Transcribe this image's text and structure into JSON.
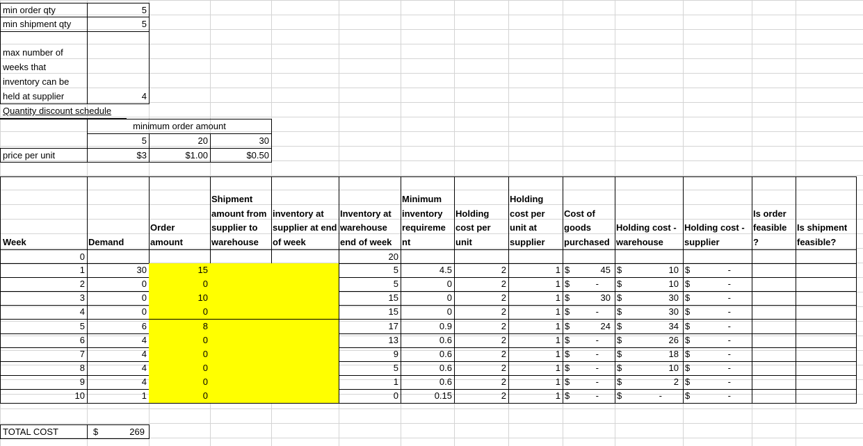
{
  "params": {
    "min_order_qty_label": "min order qty",
    "min_order_qty": "5",
    "min_shipment_qty_label": "min shipment qty",
    "min_shipment_qty": "5",
    "max_weeks_label_1": "max number of",
    "max_weeks_label_2": "weeks that",
    "max_weeks_label_3": "inventory can be",
    "max_weeks_label_4": "held at supplier",
    "max_weeks": "4"
  },
  "discount": {
    "title": "Quantity discount schedule",
    "min_order_label": "minimum order amount",
    "amounts": [
      "5",
      "20",
      "30"
    ],
    "price_label": "price per unit",
    "prices": [
      "$3",
      "$1.00",
      "$0.50"
    ]
  },
  "headers": {
    "week": "Week",
    "demand": "Demand",
    "order": "Order amount",
    "shipment": "Shipment amount from supplier to warehouse",
    "inv_supplier": "inventory at supplier at end of week",
    "inv_warehouse": "Inventory at warehouse end of week",
    "min_inv": "Minimum inventory requireme nt",
    "holding_unit": "Holding cost per unit",
    "holding_supplier_unit": "Holding cost per unit at supplier",
    "cost_goods": "Cost of goods purchased",
    "hc_warehouse": "Holding cost - warehouse",
    "hc_supplier": "Holding cost - supplier",
    "order_feasible": "Is order feasible ?",
    "ship_feasible": "Is shipment feasible?"
  },
  "rows": [
    {
      "week": "0",
      "demand": "",
      "order": "",
      "inv_wh": "20",
      "min_inv": "",
      "hold": "",
      "hold_sup": "",
      "cog": "",
      "hcw": "",
      "hcs": ""
    },
    {
      "week": "1",
      "demand": "30",
      "order": "15",
      "inv_wh": "5",
      "min_inv": "4.5",
      "hold": "2",
      "hold_sup": "1",
      "cog": "45",
      "hcw": "10",
      "hcs": "-"
    },
    {
      "week": "2",
      "demand": "0",
      "order": "0",
      "inv_wh": "5",
      "min_inv": "0",
      "hold": "2",
      "hold_sup": "1",
      "cog": "-",
      "hcw": "10",
      "hcs": "-"
    },
    {
      "week": "3",
      "demand": "0",
      "order": "10",
      "inv_wh": "15",
      "min_inv": "0",
      "hold": "2",
      "hold_sup": "1",
      "cog": "30",
      "hcw": "30",
      "hcs": "-"
    },
    {
      "week": "4",
      "demand": "0",
      "order": "0",
      "inv_wh": "15",
      "min_inv": "0",
      "hold": "2",
      "hold_sup": "1",
      "cog": "-",
      "hcw": "30",
      "hcs": "-"
    },
    {
      "week": "5",
      "demand": "6",
      "order": "8",
      "inv_wh": "17",
      "min_inv": "0.9",
      "hold": "2",
      "hold_sup": "1",
      "cog": "24",
      "hcw": "34",
      "hcs": "-"
    },
    {
      "week": "6",
      "demand": "4",
      "order": "0",
      "inv_wh": "13",
      "min_inv": "0.6",
      "hold": "2",
      "hold_sup": "1",
      "cog": "-",
      "hcw": "26",
      "hcs": "-"
    },
    {
      "week": "7",
      "demand": "4",
      "order": "0",
      "inv_wh": "9",
      "min_inv": "0.6",
      "hold": "2",
      "hold_sup": "1",
      "cog": "-",
      "hcw": "18",
      "hcs": "-"
    },
    {
      "week": "8",
      "demand": "4",
      "order": "0",
      "inv_wh": "5",
      "min_inv": "0.6",
      "hold": "2",
      "hold_sup": "1",
      "cog": "-",
      "hcw": "10",
      "hcs": "-"
    },
    {
      "week": "9",
      "demand": "4",
      "order": "0",
      "inv_wh": "1",
      "min_inv": "0.6",
      "hold": "2",
      "hold_sup": "1",
      "cog": "-",
      "hcw": "2",
      "hcs": "-"
    },
    {
      "week": "10",
      "demand": "1",
      "order": "0",
      "inv_wh": "0",
      "min_inv": "0.15",
      "hold": "2",
      "hold_sup": "1",
      "cog": "-",
      "hcw": "-",
      "hcs": "-"
    }
  ],
  "total": {
    "label": "TOTAL COST",
    "currency": "$",
    "value": "269"
  },
  "colors": {
    "highlight": "#ffff00",
    "grid": "#d4d4d4",
    "border": "#000000"
  }
}
